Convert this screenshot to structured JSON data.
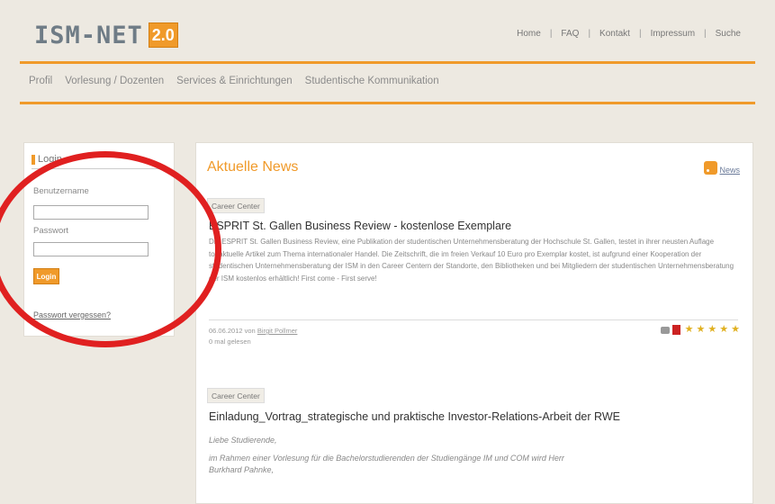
{
  "header": {
    "logo_text": "ISM-NET",
    "logo_badge": "2.0",
    "top_nav": [
      "Home",
      "FAQ",
      "Kontakt",
      "Impressum",
      "Suche"
    ],
    "top_nav_separator": "|",
    "main_nav": [
      "Profil",
      "Vorlesung / Dozenten",
      "Services & Einrichtungen",
      "Studentische Kommunikation"
    ]
  },
  "login": {
    "title": "Login",
    "username_label": "Benutzername",
    "password_label": "Passwort",
    "button_label": "Login",
    "forgot_link": "Passwort vergessen?"
  },
  "news": {
    "heading": "Aktuelle News",
    "rss_label": "News",
    "articles": [
      {
        "category": "Career Center",
        "title": "ESPRIT St. Gallen Business Review - kostenlose Exemplare",
        "body": "Die ESPRIT St. Gallen Business Review, eine Publikation der studentischen Unternehmensberatung der Hochschule St. Gallen, testet in ihrer neusten Auflage topaktuelle Artikel zum Thema internationaler Handel. Die Zeitschrift, die im freien Verkauf 10 Euro pro Exemplar kostet, ist aufgrund einer Kooperation der studentischen Unternehmensberatung der ISM in den Career Centern der Standorte, den Bibliotheken und bei Mitgliedern der studentischen Unternehmensberatung der ISM kostenlos erhältlich! First come - First serve!",
        "date": "06.06.2012 von",
        "author": "Birgit Pollmer",
        "reads": "0 mal gelesen"
      },
      {
        "category": "Career Center",
        "title": "Einladung_Vortrag_strategische und praktische Investor-Relations-Arbeit der RWE",
        "greeting": "Liebe Studierende,",
        "body_line1": "im Rahmen einer Vorlesung für die Bachelorstudierenden der Studiengänge IM und COM  wird Herr",
        "body_line2": "Burkhard Pahnke,"
      }
    ]
  },
  "colors": {
    "accent": "#f09a2a",
    "annotation_circle": "#e02020"
  }
}
